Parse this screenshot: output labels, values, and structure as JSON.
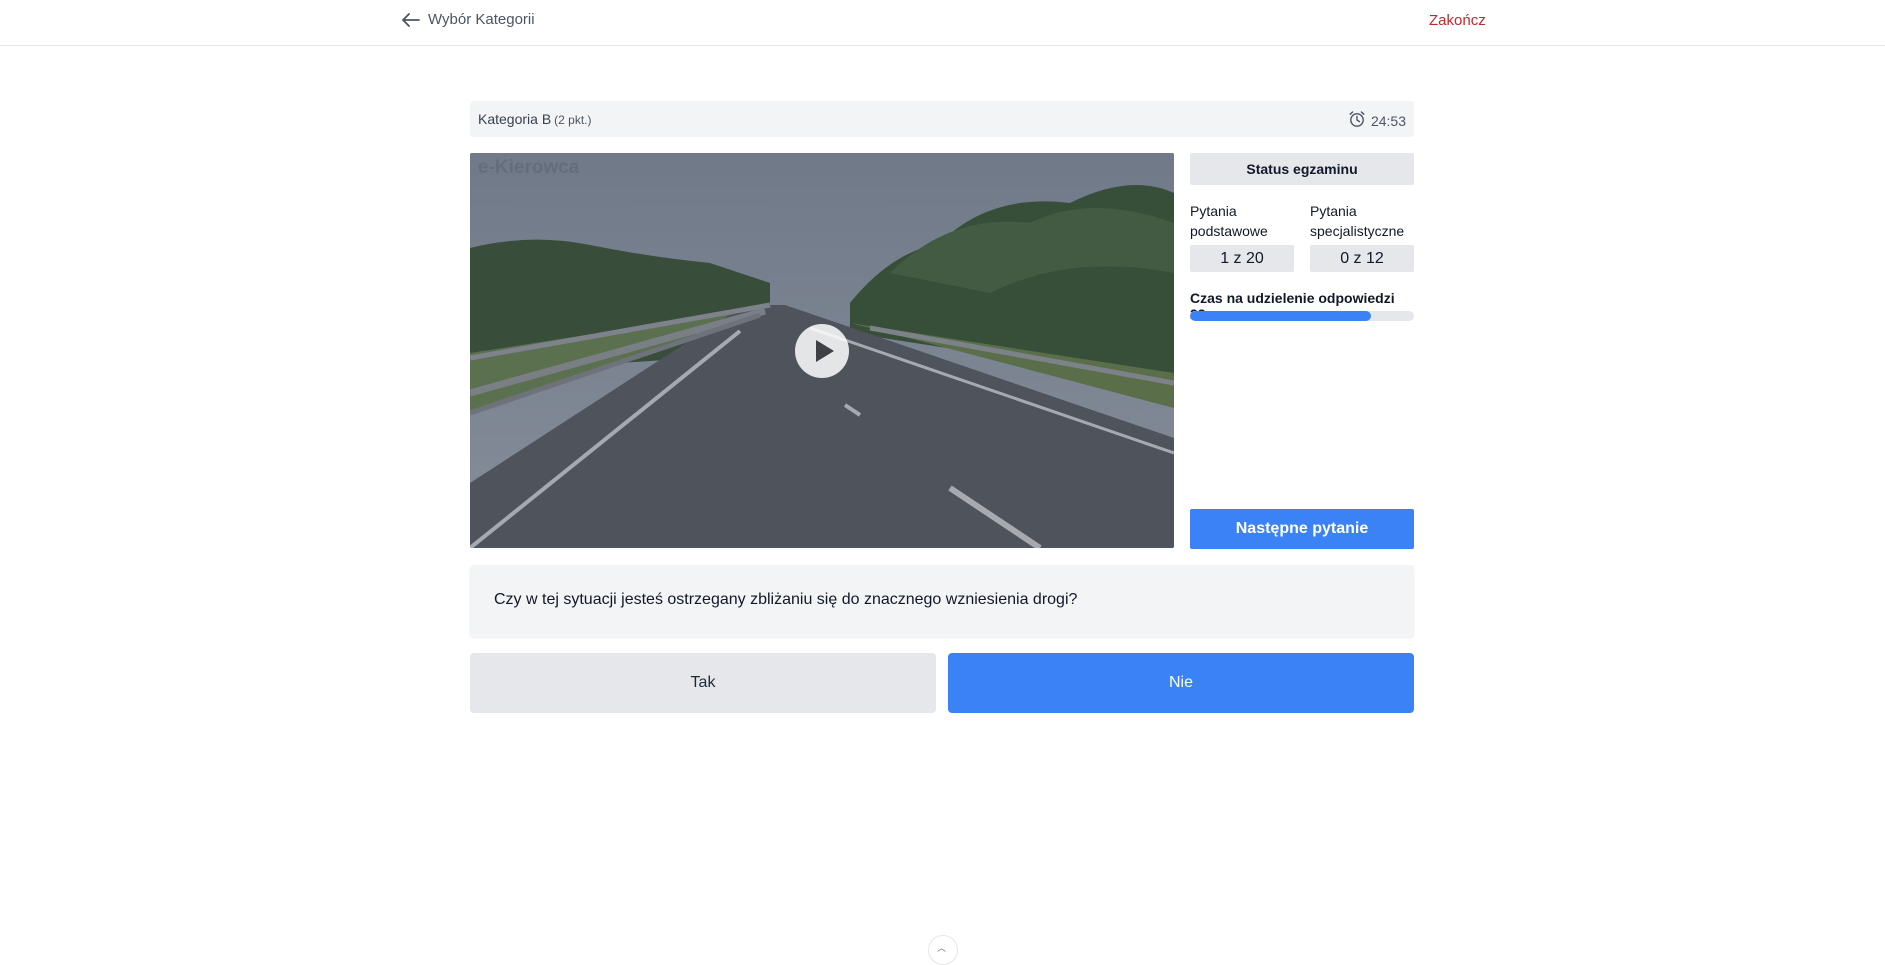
{
  "header": {
    "back_label": "Wybór Kategorii",
    "finish_label": "Zakończ"
  },
  "category_bar": {
    "name": "Kategoria B",
    "points": "(2 pkt.)",
    "timer": "24:53"
  },
  "media": {
    "watermark": "e-Kierowca",
    "play_icon": "play-icon"
  },
  "status": {
    "title": "Status egzaminu",
    "basic_label": "Pytania podstawowe",
    "basic_value": "1 z 20",
    "special_label": "Pytania specjalistyczne",
    "special_value": "0 z 12",
    "time_label": "Czas na udzielenie odpowiedzi 28s",
    "time_progress_fraction": 0.81,
    "next_label": "Następne pytanie"
  },
  "question": {
    "text": "Czy w tej sytuacji jesteś ostrzegany zbliżaniu się do znacznego wzniesienia drogi?"
  },
  "answers": {
    "yes": "Tak",
    "no": "Nie"
  },
  "colors": {
    "accent": "#3b82f6",
    "finish": "#c0282d",
    "panel": "#f3f4f6"
  }
}
